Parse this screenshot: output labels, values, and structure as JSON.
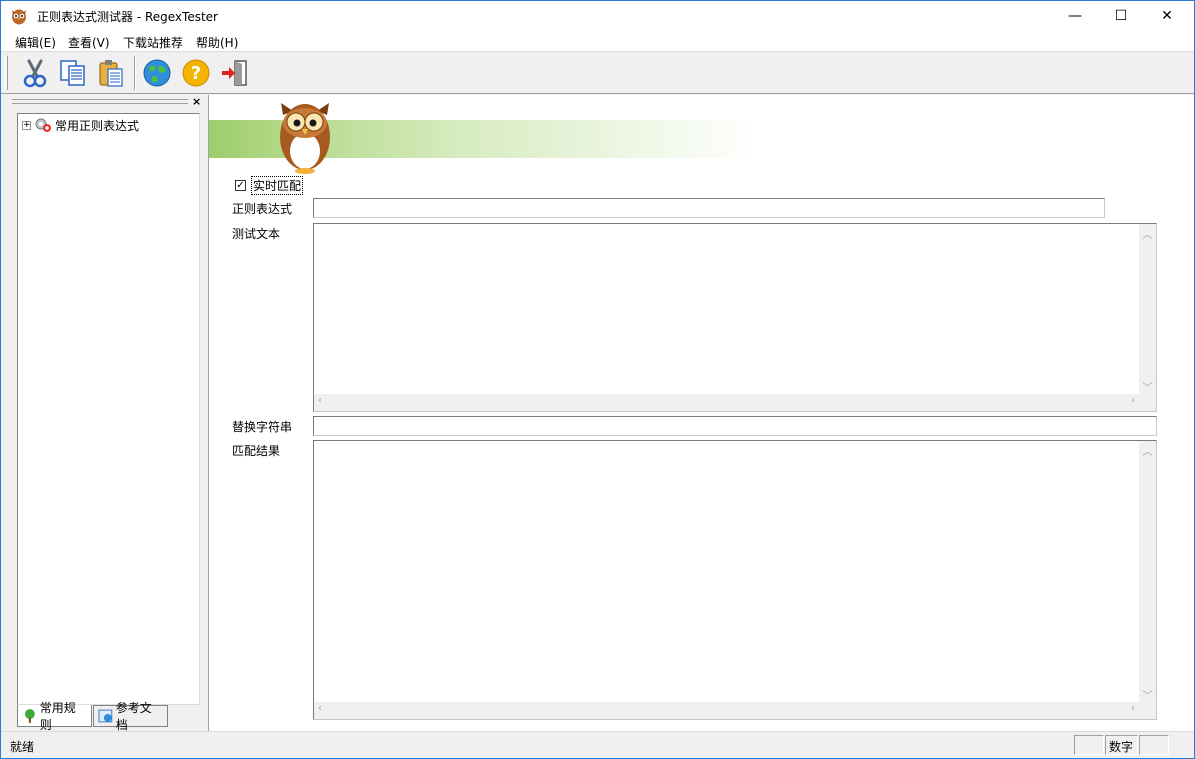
{
  "window": {
    "title": "正则表达式测试器 - RegexTester",
    "minimize_glyph": "—",
    "maximize_glyph": "☐",
    "close_glyph": "✕"
  },
  "menu": [
    {
      "label": "编辑(E)"
    },
    {
      "label": "查看(V)"
    },
    {
      "label": "下载站推荐"
    },
    {
      "label": "帮助(H)"
    }
  ],
  "toolbar": {
    "buttons": [
      {
        "icon": "scissors-icon",
        "name": "cut-button"
      },
      {
        "icon": "copy-icon",
        "name": "copy-button"
      },
      {
        "icon": "paste-icon",
        "name": "paste-button"
      },
      {
        "icon": "globe-icon",
        "name": "web-button"
      },
      {
        "icon": "help-icon",
        "name": "help-button"
      },
      {
        "icon": "exit-door-icon",
        "name": "exit-button"
      }
    ]
  },
  "left_panel": {
    "close_glyph": "×",
    "tree": {
      "root_label": "常用正则表达式",
      "expander": "+"
    },
    "tabs": [
      {
        "label": "常用规则",
        "active": true
      },
      {
        "label": "参考文档",
        "active": false
      }
    ]
  },
  "form": {
    "realtime_checkbox": {
      "label": "实时匹配",
      "checked": true,
      "check_glyph": "✓"
    },
    "regex_label": "正则表达式",
    "regex_value": "",
    "test_text_label": "测试文本",
    "test_text_value": "",
    "replace_label": "替换字符串",
    "replace_value": "",
    "result_label": "匹配结果",
    "result_value": ""
  },
  "statusbar": {
    "text": "就绪",
    "num_indicator": "数字"
  },
  "colors": {
    "accent_border": "#2b7bd4",
    "banner_green": "#9ccd6c"
  }
}
